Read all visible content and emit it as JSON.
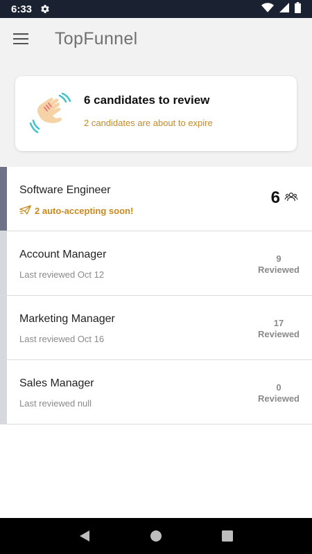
{
  "status_bar": {
    "time": "6:33",
    "icons": [
      "gear-icon",
      "wifi-icon",
      "signal-icon",
      "battery-icon"
    ]
  },
  "app_bar": {
    "title": "TopFunnel",
    "menu_icon": "hamburger-menu-icon"
  },
  "review_card": {
    "icon": "waving-hand-icon",
    "title": "6 candidates to review",
    "subtitle": "2 candidates are about to expire",
    "accent_color": "#c28a2a"
  },
  "jobs": [
    {
      "title": "Software Engineer",
      "alert": "2 auto-accepting soon!",
      "count": "6",
      "count_icon": "people-icon",
      "active": true
    },
    {
      "title": "Account Manager",
      "subtitle": "Last reviewed Oct 12",
      "reviewed_count": "9",
      "reviewed_label": "Reviewed"
    },
    {
      "title": "Marketing Manager",
      "subtitle": "Last reviewed Oct 16",
      "reviewed_count": "17",
      "reviewed_label": "Reviewed"
    },
    {
      "title": "Sales Manager",
      "subtitle": "Last reviewed null",
      "reviewed_count": "0",
      "reviewed_label": "Reviewed"
    }
  ],
  "nav_bar": {
    "buttons": [
      "back-icon",
      "home-icon",
      "recents-icon"
    ]
  },
  "colors": {
    "status_bar": "#1a2130",
    "active_bar": "#6e7187",
    "inactive_bar": "#d7d7de",
    "alert": "#c88a1d"
  }
}
